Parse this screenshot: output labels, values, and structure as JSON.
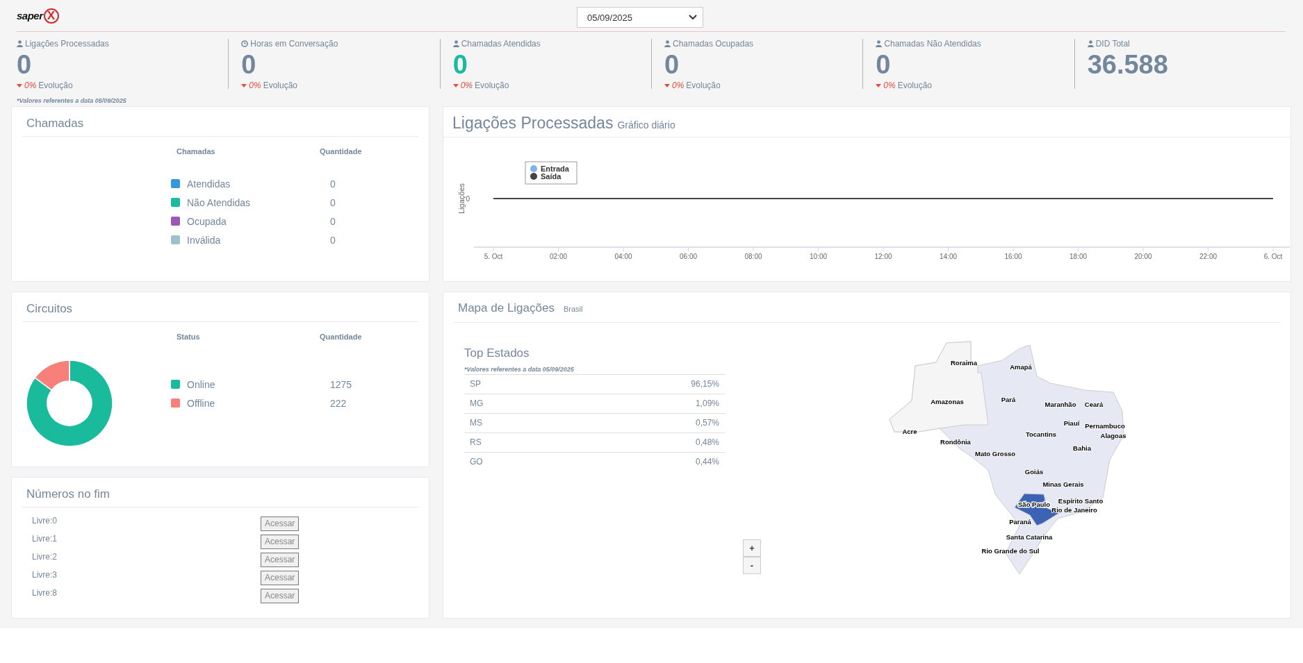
{
  "header": {
    "logo_text": "saper",
    "logo_mark": "X",
    "date_select": "05/09/2025"
  },
  "stats": [
    {
      "label": "Ligações Processadas",
      "value": "0",
      "color": "#73879c",
      "change": "0%",
      "change_label": "Evolução"
    },
    {
      "label": "Horas em Conversação",
      "value": "0",
      "color": "#73879c",
      "change": "0%",
      "change_label": "Evolução"
    },
    {
      "label": "Chamadas Atendidas",
      "value": "0",
      "color": "#1abb9c",
      "change": "0%",
      "change_label": "Evolução"
    },
    {
      "label": "Chamadas Ocupadas",
      "value": "0",
      "color": "#73879c",
      "change": "0%",
      "change_label": "Evolução"
    },
    {
      "label": "Chamadas Não Atendidas",
      "value": "0",
      "color": "#73879c",
      "change": "0%",
      "change_label": "Evolução"
    },
    {
      "label": "DID Total",
      "value": "36.588",
      "color": "#73879c"
    }
  ],
  "stats_note": "*Valores referentes a data 05/09/2025",
  "calls_panel": {
    "title": "Chamadas",
    "columns": [
      "Chamadas",
      "Quantidade"
    ],
    "rows": [
      {
        "label": "Atendidas",
        "value": "0",
        "color": "#3498db"
      },
      {
        "label": "Não Atendidas",
        "value": "0",
        "color": "#1abb9c"
      },
      {
        "label": "Ocupada",
        "value": "0",
        "color": "#9b59b6"
      },
      {
        "label": "Inválida",
        "value": "0",
        "color": "#9cc2cb"
      }
    ]
  },
  "circuits_panel": {
    "title": "Circuitos",
    "columns": [
      "Status",
      "Quantidade"
    ],
    "rows": [
      {
        "label": "Online",
        "value": "1275",
        "color": "#1abb9c"
      },
      {
        "label": "Offline",
        "value": "222",
        "color": "#f7807a"
      }
    ]
  },
  "numbers_panel": {
    "title": "Números no fim",
    "rows": [
      {
        "label": "Livre:0",
        "button": "Acessar"
      },
      {
        "label": "Livre:1",
        "button": "Acessar"
      },
      {
        "label": "Livre:2",
        "button": "Acessar"
      },
      {
        "label": "Livre:3",
        "button": "Acessar"
      },
      {
        "label": "Livre:8",
        "button": "Acessar"
      }
    ]
  },
  "calls_chart_panel": {
    "title": "Ligações Processadas",
    "subtitle": "Gráfico diário",
    "y_label": "Ligações",
    "y_tick": "0",
    "x_labels": [
      "5. Oct",
      "02:00",
      "04:00",
      "06:00",
      "08:00",
      "10:00",
      "12:00",
      "14:00",
      "16:00",
      "18:00",
      "20:00",
      "22:00",
      "6. Oct"
    ],
    "legend": [
      {
        "name": "Entrada",
        "color": "#7cb5ec"
      },
      {
        "name": "Saída",
        "color": "#434348"
      }
    ]
  },
  "map_panel": {
    "title": "Mapa de Ligações",
    "subtitle": "Brasil",
    "top_title": "Top Estados",
    "top_note": "*Valores referentes a data 05/09/2025",
    "top_rows": [
      {
        "state": "SP",
        "share": "96,15%"
      },
      {
        "state": "MG",
        "share": "1,09%"
      },
      {
        "state": "MS",
        "share": "0,57%"
      },
      {
        "state": "RS",
        "share": "0,48%"
      },
      {
        "state": "GO",
        "share": "0,44%"
      }
    ],
    "zoom_in": "+",
    "zoom_out": "-",
    "map_labels": [
      "Roraima",
      "Amapá",
      "Amazonas",
      "Pará",
      "Maranhão",
      "Ceará",
      "Piauí",
      "Pernambuco",
      "Alagoas",
      "Acre",
      "Tocantins",
      "Rondônia",
      "Bahia",
      "Mato Grosso",
      "Goiás",
      "Minas Gerais",
      "São Paulo",
      "Espírito Santo",
      "Rio de Janeiro",
      "Paraná",
      "Santa Catarina",
      "Rio Grande do Sul"
    ]
  }
}
